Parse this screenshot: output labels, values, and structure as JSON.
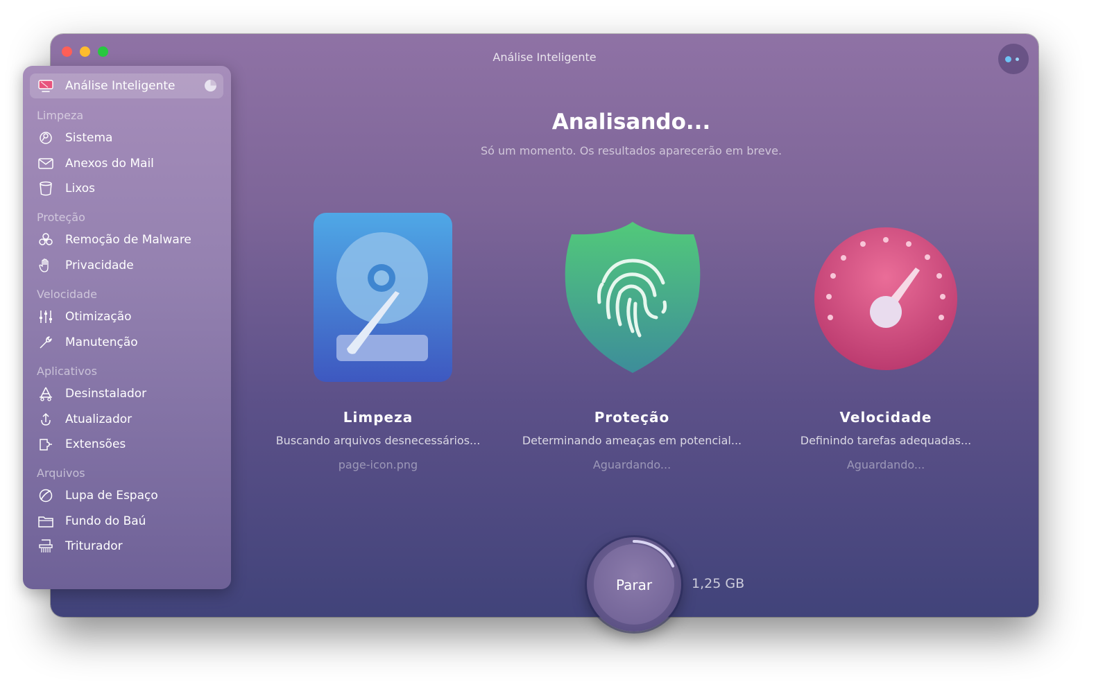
{
  "window": {
    "title": "Análise Inteligente"
  },
  "sidebar": {
    "active_item": "Análise Inteligente",
    "sections": [
      {
        "heading": "Limpeza",
        "items": [
          "Sistema",
          "Anexos do Mail",
          "Lixos"
        ]
      },
      {
        "heading": "Proteção",
        "items": [
          "Remoção de Malware",
          "Privacidade"
        ]
      },
      {
        "heading": "Velocidade",
        "items": [
          "Otimização",
          "Manutenção"
        ]
      },
      {
        "heading": "Aplicativos",
        "items": [
          "Desinstalador",
          "Atualizador",
          "Extensões"
        ]
      },
      {
        "heading": "Arquivos",
        "items": [
          "Lupa de Espaço",
          "Fundo do Baú",
          "Triturador"
        ]
      }
    ]
  },
  "main": {
    "title": "Analisando...",
    "subtitle": "Só um momento. Os resultados aparecerão em breve.",
    "cards": [
      {
        "title": "Limpeza",
        "description": "Buscando arquivos desnecessários...",
        "status": "page-icon.png"
      },
      {
        "title": "Proteção",
        "description": "Determinando ameaças em potencial...",
        "status": "Aguardando..."
      },
      {
        "title": "Velocidade",
        "description": "Definindo tarefas adequadas...",
        "status": "Aguardando..."
      }
    ],
    "stop_button": "Parar",
    "size": "1,25 GB",
    "progress": 0.18
  },
  "colors": {
    "close": "#fe5f57",
    "minimize": "#febc2e",
    "maximize": "#28c840",
    "cleanup_icon": "#4a7fd4",
    "protection_icon": "#3fae8f",
    "speed_icon": "#d84c7c",
    "progress_ring": "#d9d4f2"
  }
}
